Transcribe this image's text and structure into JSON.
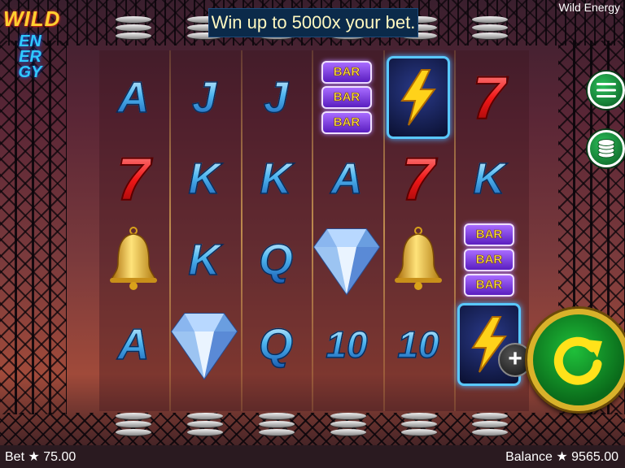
{
  "window": {
    "title": "Wild Energy"
  },
  "logo": {
    "word1": "WILD",
    "word2": "ENERGY"
  },
  "banner": {
    "text": "Win up to 5000x your bet."
  },
  "reels": [
    [
      "A",
      "7",
      "bell",
      "A"
    ],
    [
      "J",
      "K",
      "K",
      "diamond"
    ],
    [
      "J",
      "K",
      "Q",
      "Q"
    ],
    [
      "BAR",
      "A",
      "diamond",
      "10"
    ],
    [
      "bolt",
      "7",
      "bell",
      "10"
    ],
    [
      "7",
      "K",
      "BAR",
      "bolt"
    ]
  ],
  "bar_symbol": {
    "label": "BAR"
  },
  "footer": {
    "bet_label": "Bet",
    "bet_value": "75.00",
    "balance_label": "Balance",
    "balance_value": "9565.00",
    "star_symbol": "★"
  },
  "controls": {
    "plus_label": "+"
  },
  "icons": {
    "menu": "hamburger-menu-icon",
    "coins": "coin-stack-icon",
    "spin": "spin-arrow-icon"
  },
  "colors": {
    "accent_green": "#1aa83a",
    "spin_gold": "#d9b22a",
    "banner_bg": "#0b2a4a"
  }
}
